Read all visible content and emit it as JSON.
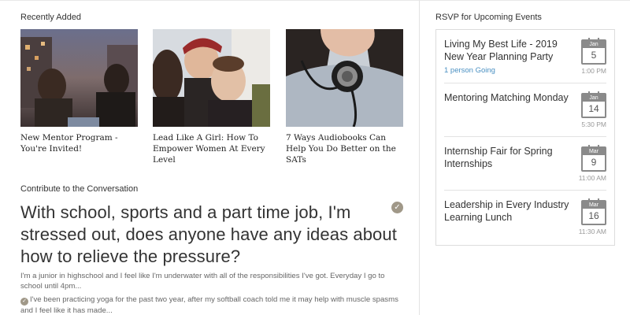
{
  "recently_added": {
    "heading": "Recently Added",
    "cards": [
      {
        "title": "New Mentor Program - You're Invited!"
      },
      {
        "title": "Lead Like A Girl: How To Empower Women At Every Level"
      },
      {
        "title": "7 Ways Audiobooks Can Help You Do Better on the SATs"
      }
    ]
  },
  "conversation": {
    "heading": "Contribute to the Conversation",
    "question": "With school, sports and a part time job, I'm stressed out, does anyone have any ideas about how to relieve the pressure?",
    "body": "I'm a junior in highschool and I feel like I'm underwater with all of the responsibilities I've got. Everyday I go to school until 4pm...",
    "answer": "I've been practicing yoga for the past two year, after my softball coach told me it may help with muscle spasms and I feel like it has made..."
  },
  "rsvp": {
    "heading": "RSVP for Upcoming Events",
    "events": [
      {
        "title": "Living My Best Life - 2019 New Year Planning Party",
        "going": "1 person Going",
        "month": "Jan",
        "day": "5",
        "time": "1:00 PM"
      },
      {
        "title": "Mentoring Matching Monday",
        "going": "",
        "month": "Jan",
        "day": "14",
        "time": "5:30 PM"
      },
      {
        "title": "Internship Fair for Spring Internships",
        "going": "",
        "month": "Mar",
        "day": "9",
        "time": "11:00 AM"
      },
      {
        "title": "Leadership in Every Industry Learning Lunch",
        "going": "",
        "month": "Mar",
        "day": "16",
        "time": "11:30 AM"
      }
    ]
  },
  "colors": {
    "accent_link": "#4a90c2",
    "check_badge": "#a09888"
  },
  "icons": {
    "answered": "check-circle-icon",
    "event_date": "calendar-icon"
  }
}
